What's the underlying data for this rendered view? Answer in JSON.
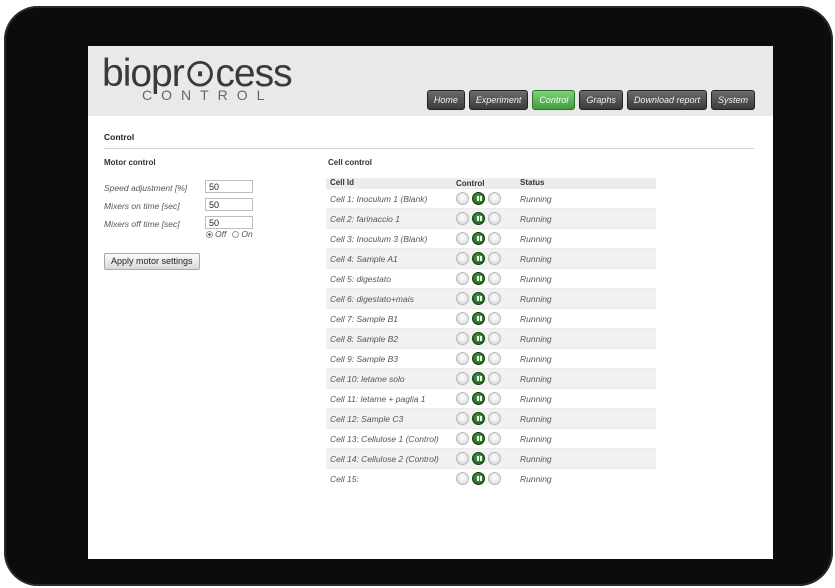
{
  "brand": {
    "logo_main": "biopr⊙cess",
    "logo_sub": "CONTROL"
  },
  "nav": [
    {
      "label": "Home",
      "active": false
    },
    {
      "label": "Experiment",
      "active": false
    },
    {
      "label": "Control",
      "active": true
    },
    {
      "label": "Graphs",
      "active": false
    },
    {
      "label": "Download report",
      "active": false
    },
    {
      "label": "System",
      "active": false
    }
  ],
  "page": {
    "title": "Control"
  },
  "motor": {
    "title": "Motor control",
    "speed_label": "Speed adjustment [%]",
    "speed_value": "50",
    "on_label": "Mixers on time [sec]",
    "on_value": "50",
    "off_label": "Mixers off time [sec]",
    "off_value": "50",
    "radio_off": "Off",
    "radio_on": "On",
    "radio_selected": "Off",
    "apply_label": "Apply motor settings"
  },
  "cells": {
    "title": "Cell control",
    "headers": {
      "id": "Cell Id",
      "control": "Control",
      "status": "Status"
    },
    "rows": [
      {
        "id": "Cell 1: Inoculum 1 (Blank)",
        "status": "Running"
      },
      {
        "id": "Cell 2: farinaccio 1",
        "status": "Running"
      },
      {
        "id": "Cell 3: Inoculum 3 (Blank)",
        "status": "Running"
      },
      {
        "id": "Cell 4: Sample A1",
        "status": "Running"
      },
      {
        "id": "Cell 5: digestato",
        "status": "Running"
      },
      {
        "id": "Cell 6: digestato+mais",
        "status": "Running"
      },
      {
        "id": "Cell 7: Sample B1",
        "status": "Running"
      },
      {
        "id": "Cell 8: Sample B2",
        "status": "Running"
      },
      {
        "id": "Cell 9: Sample B3",
        "status": "Running"
      },
      {
        "id": "Cell 10: letame solo",
        "status": "Running"
      },
      {
        "id": "Cell 11: letame + paglia 1",
        "status": "Running"
      },
      {
        "id": "Cell 12: Sample C3",
        "status": "Running"
      },
      {
        "id": "Cell 13: Cellulose 1 (Control)",
        "status": "Running"
      },
      {
        "id": "Cell 14: Cellulose 2 (Control)",
        "status": "Running"
      },
      {
        "id": "Cell 15:",
        "status": "Running"
      }
    ],
    "control_icons": [
      "stop-icon",
      "pause-icon",
      "play-icon"
    ]
  },
  "colors": {
    "active_nav": "#4caf50",
    "nav_dark": "#4a4a4a",
    "pause_green": "#1e6b1e"
  }
}
